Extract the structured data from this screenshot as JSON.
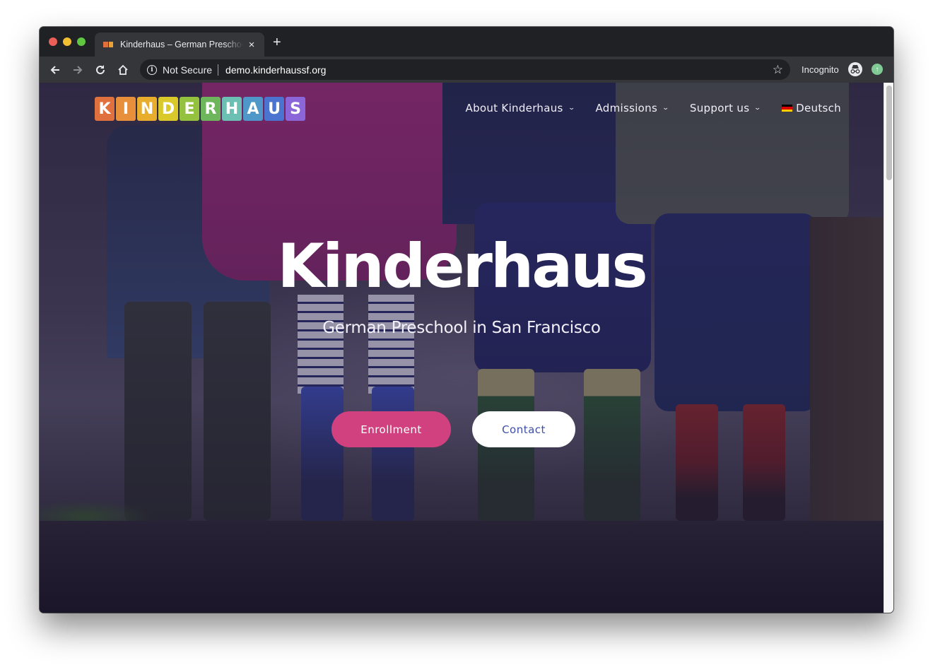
{
  "browser": {
    "tab": {
      "title": "Kinderhaus – German Preschool in San Francisco",
      "favicon_colors": [
        "#e0703e",
        "#e9a23a"
      ]
    },
    "new_tab_label": "+",
    "close_label": "×",
    "address": {
      "security_label": "Not Secure",
      "url": "demo.kinderhaussf.org"
    },
    "incognito_label": "Incognito",
    "scroll_position": 0
  },
  "site": {
    "logo": {
      "letters": [
        {
          "char": "K",
          "color": "#e0703e"
        },
        {
          "char": "I",
          "color": "#e88f3b"
        },
        {
          "char": "N",
          "color": "#e9ad2e"
        },
        {
          "char": "D",
          "color": "#d9c92a"
        },
        {
          "char": "E",
          "color": "#94c23e"
        },
        {
          "char": "R",
          "color": "#6db65b"
        },
        {
          "char": "H",
          "color": "#6cc0b3"
        },
        {
          "char": "A",
          "color": "#4f96c9"
        },
        {
          "char": "U",
          "color": "#4a74d0"
        },
        {
          "char": "S",
          "color": "#8b66d8"
        }
      ]
    },
    "nav": [
      {
        "label": "About Kinderhaus",
        "has_dropdown": true
      },
      {
        "label": "Admissions",
        "has_dropdown": true
      },
      {
        "label": "Support us",
        "has_dropdown": true
      },
      {
        "label": "Deutsch",
        "has_dropdown": false,
        "icon": "german-flag-icon"
      }
    ],
    "hero": {
      "title": "Kinderhaus",
      "subtitle": "German Preschool in San Francisco",
      "buttons": [
        {
          "label": "Enrollment",
          "color": "#d1417f"
        },
        {
          "label": "Contact",
          "color": "#ffffff",
          "text_color": "#3f4fa8"
        }
      ]
    }
  }
}
